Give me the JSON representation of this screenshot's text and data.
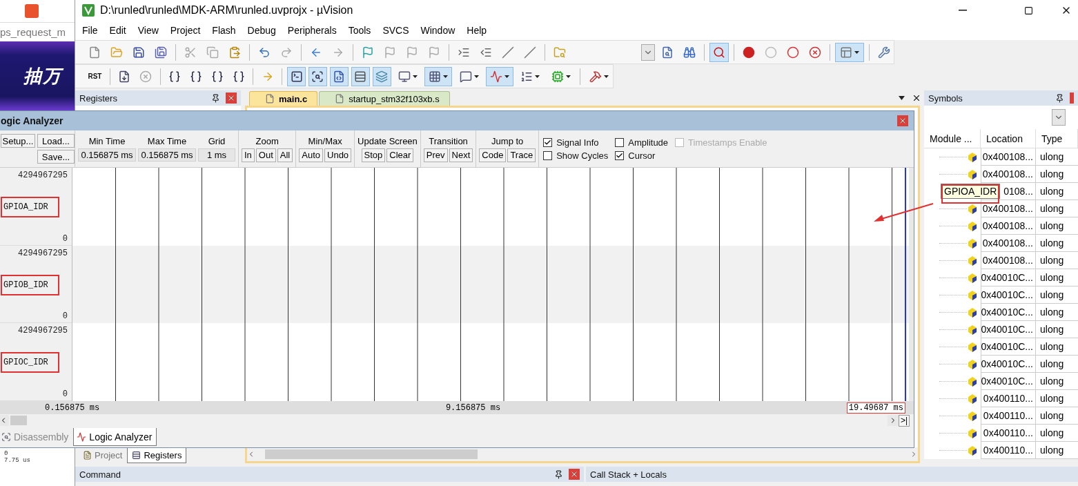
{
  "background_window": {
    "address": "ps_request_m",
    "banner": "抽万",
    "lines": [
      "0",
      "7.75 us"
    ]
  },
  "window": {
    "title": "D:\\runled\\runled\\MDK-ARM\\runled.uvprojx - µVision"
  },
  "menu": [
    "File",
    "Edit",
    "View",
    "Project",
    "Flash",
    "Debug",
    "Peripherals",
    "Tools",
    "SVCS",
    "Window",
    "Help"
  ],
  "toolbar_1": [
    {
      "kind": "button",
      "pressed": false
    },
    {
      "kind": "button",
      "pressed": false
    },
    {
      "kind": "button",
      "pressed": false
    },
    {
      "kind": "button",
      "pressed": false
    },
    {
      "kind": "separator"
    },
    {
      "kind": "button",
      "pressed": false
    },
    {
      "kind": "button",
      "pressed": false
    },
    {
      "kind": "button",
      "pressed": false
    },
    {
      "kind": "separator"
    },
    {
      "kind": "button",
      "pressed": false
    },
    {
      "kind": "button",
      "pressed": false
    },
    {
      "kind": "separator"
    },
    {
      "kind": "button",
      "pressed": false
    },
    {
      "kind": "button",
      "pressed": false
    },
    {
      "kind": "separator"
    },
    {
      "kind": "button",
      "pressed": false
    },
    {
      "kind": "button",
      "pressed": false
    },
    {
      "kind": "button",
      "pressed": false
    },
    {
      "kind": "button",
      "pressed": false
    },
    {
      "kind": "separator"
    },
    {
      "kind": "button",
      "pressed": false
    },
    {
      "kind": "button",
      "pressed": false
    },
    {
      "kind": "button",
      "pressed": false
    },
    {
      "kind": "button",
      "pressed": false
    },
    {
      "kind": "separator"
    },
    {
      "kind": "button",
      "pressed": false
    },
    {
      "kind": "combo"
    },
    {
      "kind": "button",
      "pressed": false
    },
    {
      "kind": "button",
      "pressed": false
    },
    {
      "kind": "separator"
    },
    {
      "kind": "button",
      "pressed": true
    },
    {
      "kind": "separator"
    },
    {
      "kind": "button",
      "pressed": false
    },
    {
      "kind": "button",
      "pressed": false
    },
    {
      "kind": "button",
      "pressed": false
    },
    {
      "kind": "button",
      "pressed": false
    },
    {
      "kind": "separator"
    },
    {
      "kind": "dropdown",
      "pressed": true
    },
    {
      "kind": "separator"
    },
    {
      "kind": "button",
      "pressed": false
    }
  ],
  "toolbar_2": [
    {
      "kind": "label_button",
      "label": "RST",
      "pressed": false
    },
    {
      "kind": "separator"
    },
    {
      "kind": "button",
      "pressed": false
    },
    {
      "kind": "button",
      "pressed": false
    },
    {
      "kind": "separator"
    },
    {
      "kind": "button",
      "pressed": false
    },
    {
      "kind": "button",
      "pressed": false
    },
    {
      "kind": "button",
      "pressed": false
    },
    {
      "kind": "button",
      "pressed": false
    },
    {
      "kind": "separator"
    },
    {
      "kind": "button",
      "pressed": false
    },
    {
      "kind": "separator"
    },
    {
      "kind": "button",
      "pressed": true
    },
    {
      "kind": "button",
      "pressed": true
    },
    {
      "kind": "button",
      "pressed": true
    },
    {
      "kind": "button",
      "pressed": true
    },
    {
      "kind": "button",
      "pressed": true
    },
    {
      "kind": "dropdown",
      "pressed": false
    },
    {
      "kind": "dropdown",
      "pressed": true
    },
    {
      "kind": "dropdown",
      "pressed": false
    },
    {
      "kind": "dropdown",
      "pressed": true
    },
    {
      "kind": "dropdown",
      "pressed": false
    },
    {
      "kind": "dropdown",
      "pressed": false
    },
    {
      "kind": "separator"
    },
    {
      "kind": "dropdown",
      "pressed": false
    }
  ],
  "registers_panel": {
    "title": "Registers",
    "tabs": [
      {
        "label": "Project",
        "selected": false
      },
      {
        "label": "Registers",
        "selected": true
      }
    ]
  },
  "editor": {
    "tabs": [
      {
        "label": "main.c",
        "selected": true
      },
      {
        "label": "startup_stm32f103xb.s",
        "selected": false
      }
    ]
  },
  "symbols_panel": {
    "title": "Symbols",
    "columns": [
      "Module ...",
      "Location",
      "Type"
    ],
    "rows": [
      {
        "location": "0x400108...",
        "type": "ulong"
      },
      {
        "location": "0x400108...",
        "type": "ulong"
      },
      {
        "location": "0108...",
        "type": "ulong",
        "tooltip": "GPIOA_IDR"
      },
      {
        "location": "0x400108...",
        "type": "ulong"
      },
      {
        "location": "0x400108...",
        "type": "ulong"
      },
      {
        "location": "0x400108...",
        "type": "ulong"
      },
      {
        "location": "0x400108...",
        "type": "ulong"
      },
      {
        "location": "0x40010C...",
        "type": "ulong"
      },
      {
        "location": "0x40010C...",
        "type": "ulong"
      },
      {
        "location": "0x40010C...",
        "type": "ulong"
      },
      {
        "location": "0x40010C...",
        "type": "ulong"
      },
      {
        "location": "0x40010C...",
        "type": "ulong"
      },
      {
        "location": "0x40010C...",
        "type": "ulong"
      },
      {
        "location": "0x40010C...",
        "type": "ulong"
      },
      {
        "location": "0x400110...",
        "type": "ulong"
      },
      {
        "location": "0x400110...",
        "type": "ulong"
      },
      {
        "location": "0x400110...",
        "type": "ulong"
      },
      {
        "location": "0x400110...",
        "type": "ulong"
      }
    ]
  },
  "bottom_panels": [
    {
      "title": "Command"
    },
    {
      "title": "Call Stack + Locals"
    }
  ],
  "logic_analyzer": {
    "title": "ogic Analyzer",
    "file_buttons": [
      "Setup...",
      "Load...",
      "Save..."
    ],
    "readouts": [
      {
        "label": "Min Time",
        "value": "0.156875 ms"
      },
      {
        "label": "Max Time",
        "value": "0.156875 ms"
      },
      {
        "label": "Grid",
        "value": "1 ms"
      }
    ],
    "button_groups": [
      {
        "label": "Zoom",
        "buttons": [
          "In",
          "Out",
          "All"
        ]
      },
      {
        "label": "Min/Max",
        "buttons": [
          "Auto",
          "Undo"
        ]
      },
      {
        "label": "Update Screen",
        "buttons": [
          "Stop",
          "Clear"
        ]
      },
      {
        "label": "Transition",
        "buttons": [
          "Prev",
          "Next"
        ]
      },
      {
        "label": "Jump to",
        "buttons": [
          "Code",
          "Trace"
        ]
      }
    ],
    "options": [
      {
        "label": "Signal Info",
        "checked": true,
        "disabled": false
      },
      {
        "label": "Amplitude",
        "checked": false,
        "disabled": false
      },
      {
        "label": "Timestamps Enable",
        "checked": false,
        "disabled": true
      },
      {
        "label": "Show Cycles",
        "checked": false,
        "disabled": false
      },
      {
        "label": "Cursor",
        "checked": true,
        "disabled": false
      }
    ],
    "signals": [
      {
        "name": "GPIOA_IDR",
        "max": "4294967295",
        "min": "0"
      },
      {
        "name": "GPIOB_IDR",
        "max": "4294967295",
        "min": "0"
      },
      {
        "name": "GPIOC_IDR",
        "max": "4294967295",
        "min": "0"
      }
    ],
    "time_axis": {
      "start": "0.156875 ms",
      "middle": "9.156875 ms",
      "end": "19.49687 ms"
    },
    "scroll_end_button": ">|",
    "tabs": [
      {
        "label": "Disassembly",
        "selected": false
      },
      {
        "label": "Logic Analyzer",
        "selected": true
      }
    ]
  }
}
